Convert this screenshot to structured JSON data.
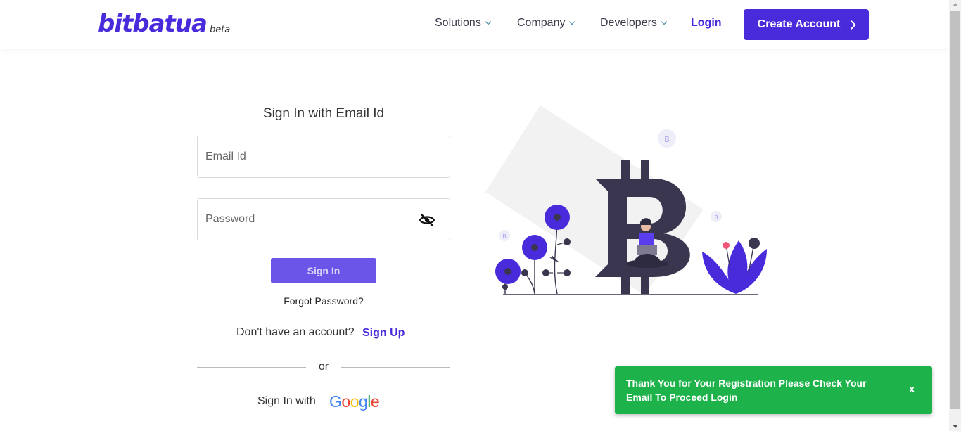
{
  "brand": {
    "name": "bitbatua",
    "tag": "beta"
  },
  "nav": {
    "solutions": "Solutions",
    "company": "Company",
    "developers": "Developers",
    "login": "Login",
    "create_account": "Create Account"
  },
  "form": {
    "title": "Sign In with Email Id",
    "email": {
      "placeholder": "Email Id",
      "value": ""
    },
    "password": {
      "placeholder": "Password",
      "value": ""
    },
    "signin_label": "Sign In",
    "forgot": "Forgot Password?",
    "no_account": "Don't have an account?",
    "signup": "Sign Up",
    "or": "or",
    "sign_in_with": "Sign In with"
  },
  "toast": {
    "message": "Thank You for Your Registration Please Check Your Email To Proceed Login",
    "close": "x",
    "color": "#1db34a"
  },
  "colors": {
    "accent": "#4a2bdc",
    "button": "#6b55e8"
  },
  "icons": [
    "chevron-down-icon",
    "chevron-right-icon",
    "eye-off-icon",
    "google-logo",
    "bitcoin-illustration"
  ]
}
